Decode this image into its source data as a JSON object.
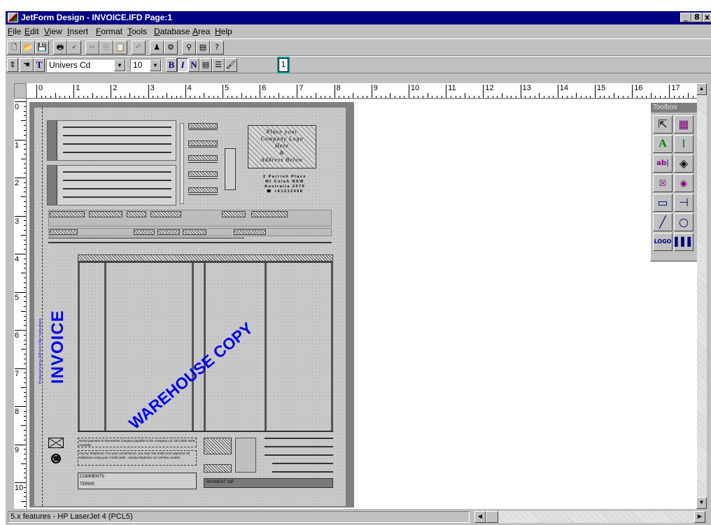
{
  "window": {
    "title": "JetForm Design - INVOICE.IFD Page:1",
    "controls": [
      "_",
      "8",
      "x"
    ]
  },
  "menu": [
    "File",
    "Edit",
    "View",
    "Insert",
    "Format",
    "Tools",
    "Database",
    "Area",
    "Help"
  ],
  "toolbar2": {
    "font_name": "Univers Cd",
    "font_size": "10",
    "bold_label": "B",
    "italic_label": "I",
    "normal_label": "N",
    "page_indicator": "1"
  },
  "ruler": {
    "h_marks": [
      "0",
      "1",
      "2",
      "3",
      "4",
      "5",
      "6",
      "7",
      "8",
      "9",
      "10",
      "11",
      "12",
      "13",
      "14",
      "15",
      "16",
      "17"
    ],
    "v_marks": [
      "0",
      "1",
      "2",
      "3",
      "4",
      "5",
      "6",
      "7",
      "8",
      "9",
      "10"
    ]
  },
  "document": {
    "invoice_label": "INVOICE",
    "warehouse_label": "WAREHOUSE COPY",
    "logo_text": [
      "Place your",
      "Company Logo",
      "Here",
      "&",
      "Address Below"
    ],
    "address": [
      "2 Parrish Place",
      "Mt Colah NSW",
      "Australia 2079",
      "☎ +61212498"
    ],
    "box_labels": [
      "COMMENTS",
      "TERMS",
      "PAYMENT INF"
    ]
  },
  "toolbox": {
    "title": "Toolbox",
    "tools": [
      "select-arrow",
      "table",
      "text",
      "field",
      "entry-field",
      "shape",
      "checkbox",
      "radio",
      "rectangle",
      "line-tee",
      "line",
      "circle",
      "logo",
      "barcode"
    ]
  },
  "status": {
    "text": "5.x features - HP LaserJet 4 (PCL5)"
  },
  "colors": {
    "title_bar": "#000080",
    "chrome": "#c0c0c0",
    "form_text": "#0000ee"
  }
}
